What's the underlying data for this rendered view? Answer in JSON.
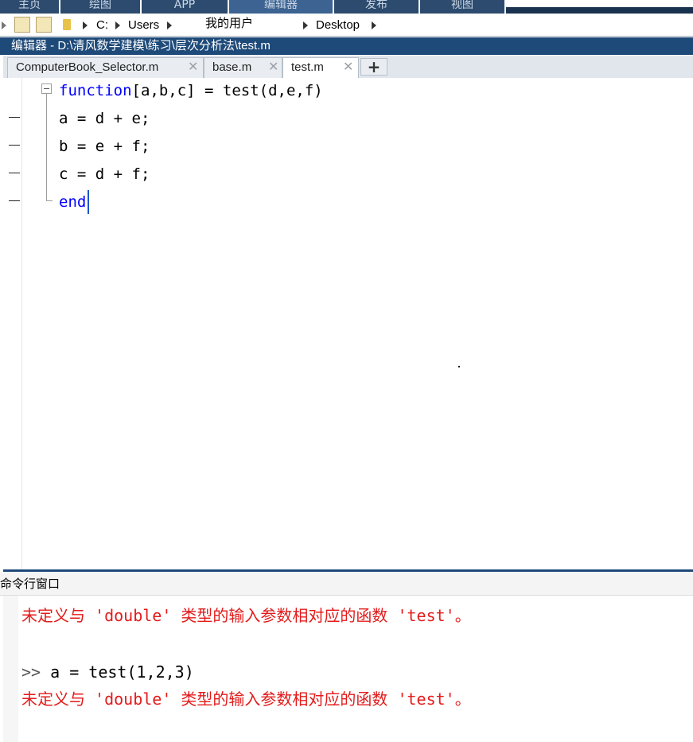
{
  "ribbon": {
    "tabs": [
      "主页",
      "绘图",
      "APP",
      "编辑器",
      "发布",
      "视图"
    ]
  },
  "address_bar": {
    "drive": "C:",
    "users": "Users",
    "user_folder": "我的用户",
    "desktop": "Desktop"
  },
  "editor": {
    "title": "编辑器 - D:\\清风数学建模\\练习\\层次分析法\\test.m",
    "tabs": [
      {
        "label": "ComputerBook_Selector.m"
      },
      {
        "label": "base.m"
      },
      {
        "label": "test.m"
      }
    ],
    "add_tab": "+",
    "code": {
      "line1_keyword": "function",
      "line1_rest": "[a,b,c] = test(d,e,f)",
      "line2": "a = d + e;",
      "line3": "b = e + f;",
      "line4": "c = d + f;",
      "line5_keyword": "end"
    }
  },
  "command_window": {
    "title": "命令行窗口",
    "error1": "未定义与 'double' 类型的输入参数相对应的函数 'test'。",
    "prompt": ">>",
    "command": "a = test(1,2,3)",
    "error2": "未定义与 'double' 类型的输入参数相对应的函数 'test'。"
  },
  "colors": {
    "title_bar": "#1e4a79",
    "keyword": "#0000ff",
    "error": "#e31b1b"
  }
}
